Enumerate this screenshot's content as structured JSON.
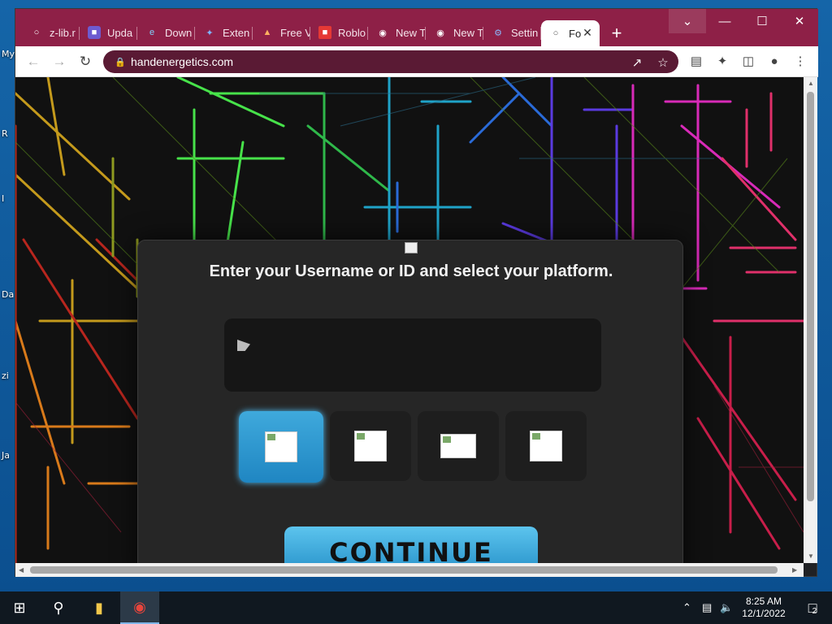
{
  "desktop": {
    "labels": [
      "My",
      "R",
      "I",
      "Da",
      "zi",
      "Ja"
    ]
  },
  "browser": {
    "tabs": [
      {
        "label": "z-lib.r",
        "icon": "globe-icon"
      },
      {
        "label": "Upda",
        "icon": "app-icon"
      },
      {
        "label": "Down",
        "icon": "edge-icon"
      },
      {
        "label": "Exten",
        "icon": "puzzle-icon"
      },
      {
        "label": "Free V",
        "icon": "site-icon"
      },
      {
        "label": "Roblo",
        "icon": "roblox-icon"
      },
      {
        "label": "New T",
        "icon": "chrome-icon"
      },
      {
        "label": "New T",
        "icon": "chrome-icon"
      },
      {
        "label": "Settin",
        "icon": "gear-icon"
      }
    ],
    "active_tab": {
      "label": "Fo",
      "icon": "globe-icon"
    },
    "url": "handenergetics.com"
  },
  "page": {
    "heading": "Enter your Username or ID and select your platform.",
    "username_value": "",
    "platform_count": 4,
    "selected_platform_index": 0,
    "continue_label": "CONTINUE"
  },
  "taskbar": {
    "time": "8:25 AM",
    "date": "12/1/2022",
    "notifications": "2"
  },
  "colors": {
    "titlebar": "#8e2047",
    "omnibox": "#5a1a34",
    "accent": "#2590c8"
  }
}
